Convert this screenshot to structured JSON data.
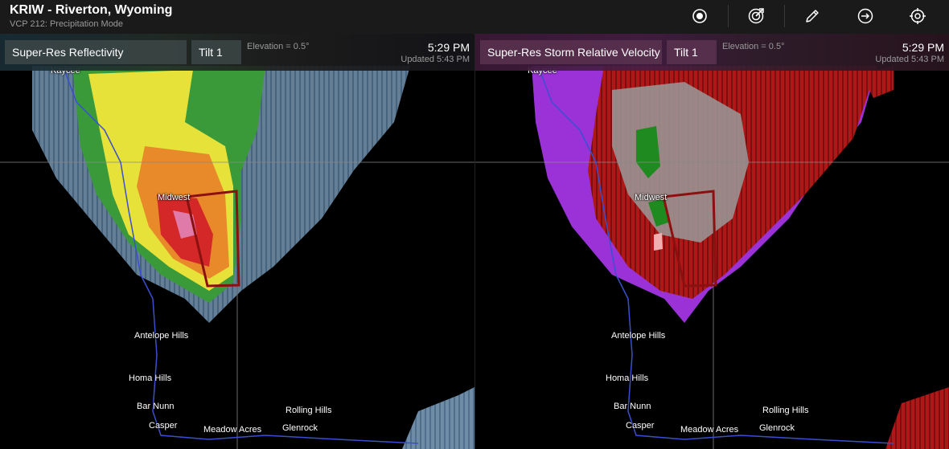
{
  "app": {
    "title": "KRIW - Riverton, Wyoming",
    "mode": "VCP 212: Precipitation Mode"
  },
  "toolbar": [
    {
      "icon": "radar-center-icon"
    },
    {
      "icon": "radar-sweep-icon"
    },
    {
      "icon": "pencil-icon"
    },
    {
      "icon": "circle-arrow-icon"
    },
    {
      "icon": "crosshair-icon"
    }
  ],
  "panels": [
    {
      "product": "Super-Res Reflectivity",
      "tilt": "Tilt 1",
      "elevation": "Elevation = 0.5°",
      "time": "5:29 PM",
      "updated": "Updated 5:43 PM"
    },
    {
      "product": "Super-Res Storm Relative Velocity",
      "tilt": "Tilt 1",
      "elevation": "Elevation = 0.5°",
      "time": "5:29 PM",
      "updated": "Updated 5:43 PM"
    }
  ],
  "towns": [
    "Kaycee",
    "Midwest",
    "Antelope Hills",
    "Homa Hills",
    "Bar Nunn",
    "Casper",
    "Meadow Acres",
    "Rolling Hills",
    "Glenrock"
  ],
  "colors": {
    "warning_polygon": "#8b1010",
    "river": "#3a4fd0",
    "road": "#8a8a8a"
  }
}
